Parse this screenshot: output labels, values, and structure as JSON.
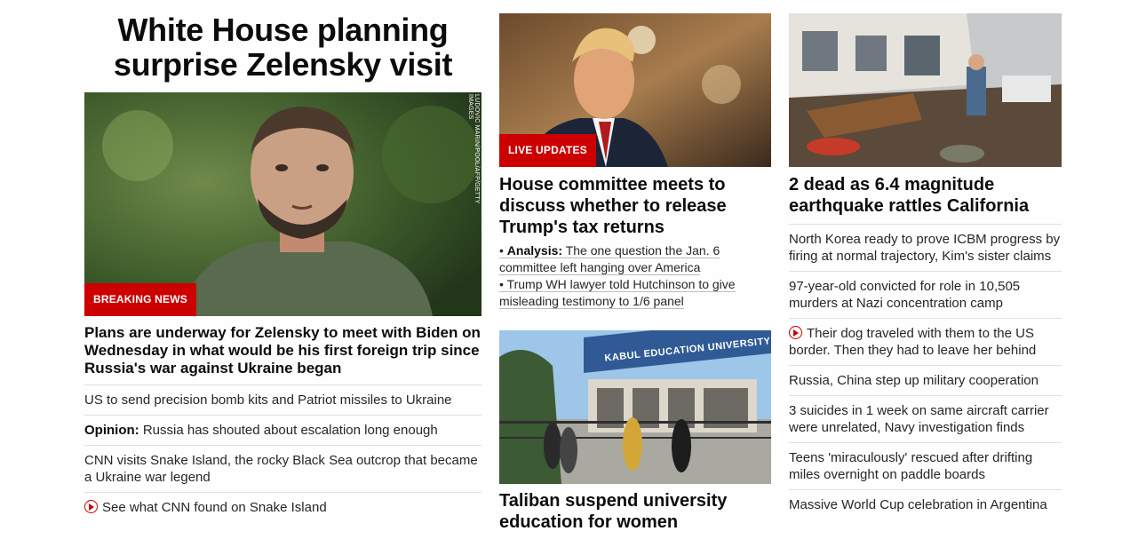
{
  "col1": {
    "title": "White House planning surprise Zelensky visit",
    "image_credit": "LUDOVIC MARIN/POOL/AFP/GETTY IMAGES",
    "badge": "BREAKING NEWS",
    "headline": "Plans are underway for Zelensky to meet with Biden on Wednesday in what would be his first foreign trip since Russia's war against Ukraine began",
    "items": [
      {
        "prefix": "",
        "text": "US to send precision bomb kits and Patriot missiles to Ukraine",
        "video": false
      },
      {
        "prefix": "Opinion:",
        "text": "Russia has shouted about escalation long enough",
        "video": false
      },
      {
        "prefix": "",
        "text": "CNN visits Snake Island, the rocky Black Sea outcrop that became a Ukraine war legend",
        "video": false
      },
      {
        "prefix": "",
        "text": "See what CNN found on Snake Island",
        "video": true
      }
    ]
  },
  "col2": {
    "badge": "LIVE UPDATES",
    "headline": "House committee meets to discuss whether to release Trump's tax returns",
    "links": [
      {
        "bullet": "•",
        "prefix": "Analysis:",
        "text": "The one question the Jan. 6 committee left hanging over America"
      },
      {
        "bullet": "•",
        "prefix": "",
        "text": "Trump WH lawyer told Hutchinson to give misleading testimony to 1/6 panel"
      }
    ],
    "sign_text": "KABUL EDUCATION UNIVERSITY",
    "headline2": "Taliban suspend university education for women"
  },
  "col3": {
    "headline": "2 dead as 6.4 magnitude earthquake rattles California",
    "items": [
      {
        "text": "North Korea ready to prove ICBM progress by firing at normal trajectory, Kim's sister claims",
        "video": false
      },
      {
        "text": "97-year-old convicted for role in 10,505 murders at Nazi concentration camp",
        "video": false
      },
      {
        "text": "Their dog traveled with them to the US border. Then they had to leave her behind",
        "video": true
      },
      {
        "text": "Russia, China step up military cooperation",
        "video": false
      },
      {
        "text": "3 suicides in 1 week on same aircraft carrier were unrelated, Navy investigation finds",
        "video": false
      },
      {
        "text": "Teens 'miraculously' rescued after drifting miles overnight on paddle boards",
        "video": false
      },
      {
        "text": "Massive World Cup celebration in Argentina",
        "video": false
      }
    ]
  },
  "colors": {
    "accent": "#cc0000",
    "text": "#0c0c0c",
    "divider": "#e0e0e0"
  }
}
